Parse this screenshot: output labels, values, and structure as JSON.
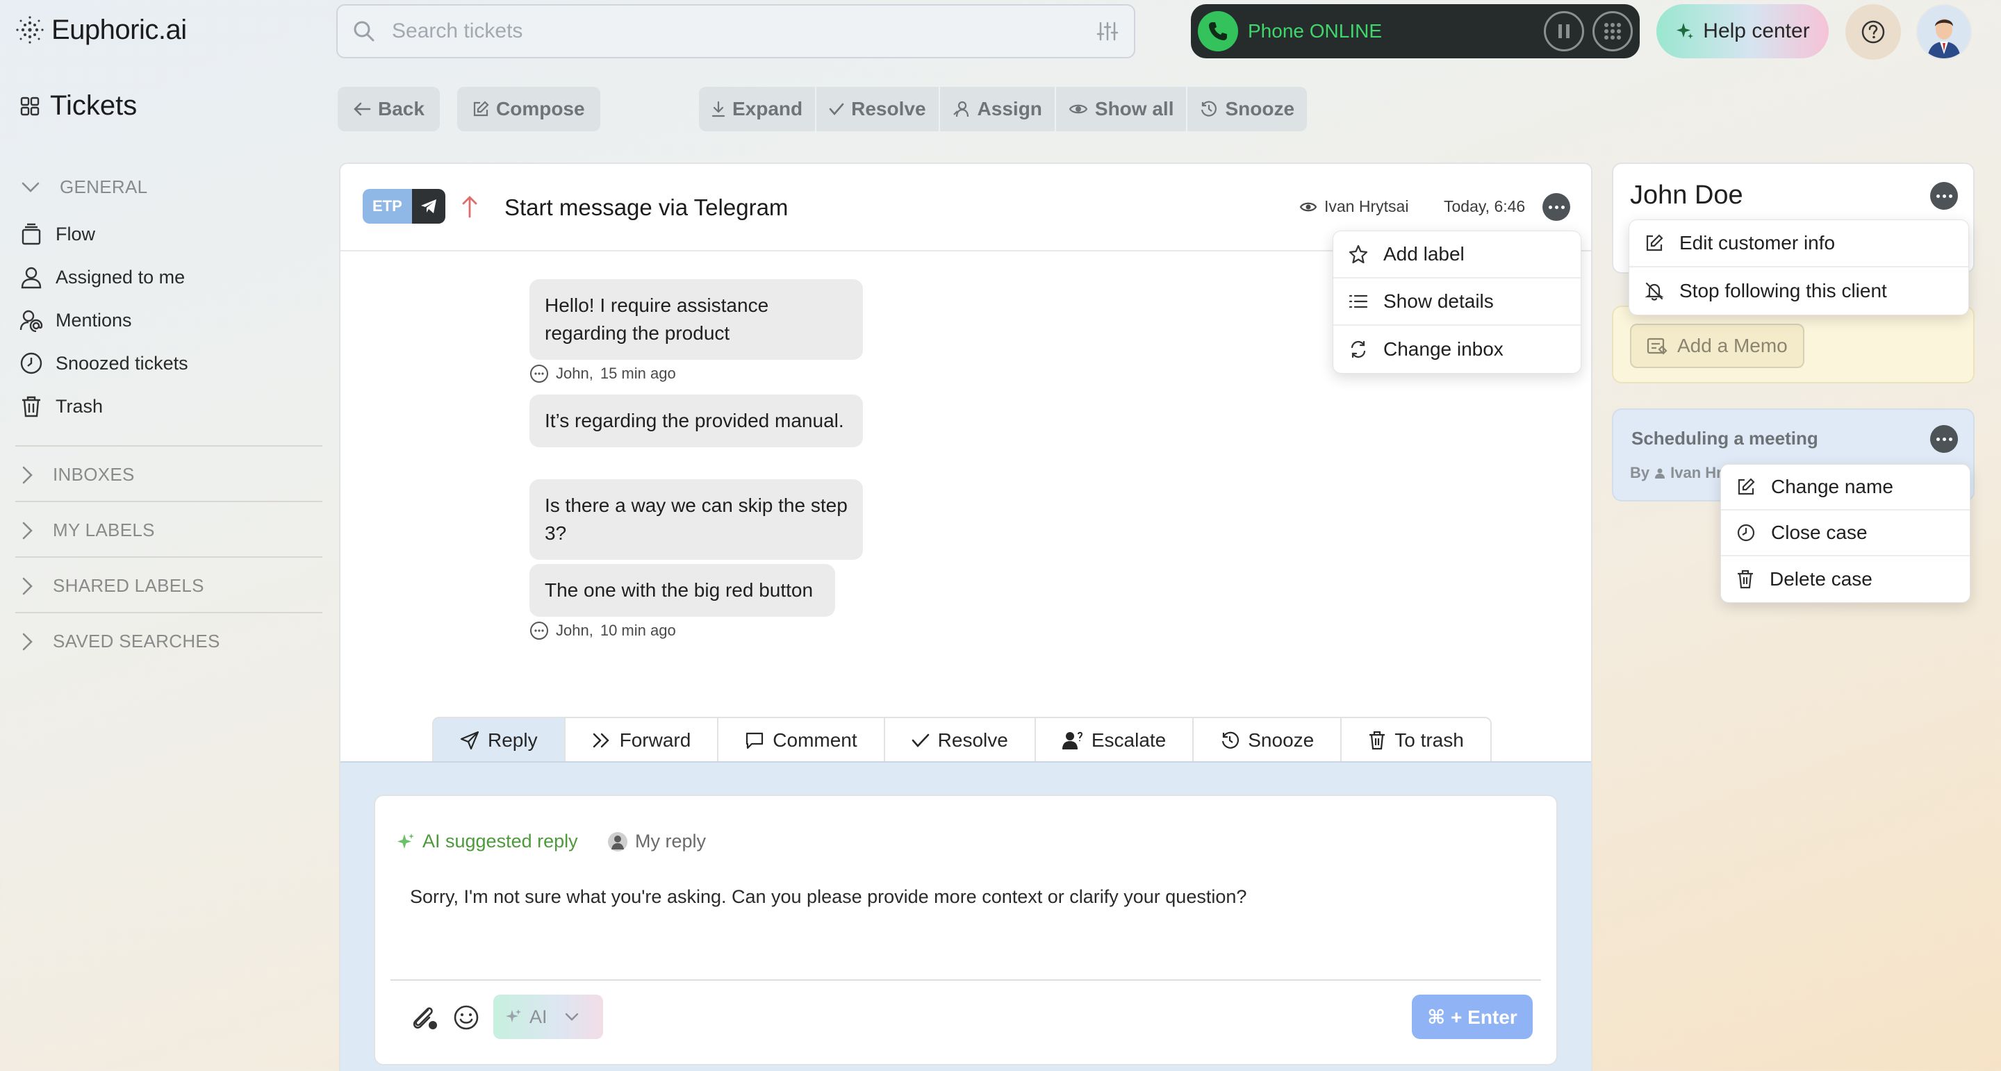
{
  "app": {
    "logo": "Euphoric.ai"
  },
  "search": {
    "placeholder": "Search tickets"
  },
  "phone": {
    "status": "Phone ONLINE"
  },
  "help": {
    "label": "Help center"
  },
  "sidebar": {
    "title": "Tickets",
    "general": {
      "label": "GENERAL",
      "items": [
        {
          "label": "Flow",
          "icon": "inbox-stack-icon"
        },
        {
          "label": "Assigned to me",
          "icon": "user-icon"
        },
        {
          "label": "Mentions",
          "icon": "at-icon"
        },
        {
          "label": "Snoozed tickets",
          "icon": "clock-icon"
        },
        {
          "label": "Trash",
          "icon": "trash-icon"
        }
      ]
    },
    "sections": [
      "INBOXES",
      "MY LABELS",
      "SHARED LABELS",
      "SAVED SEARCHES"
    ]
  },
  "toolbar": {
    "back": "Back",
    "compose": "Compose",
    "group": [
      "Expand",
      "Resolve",
      "Assign",
      "Show all",
      "Snooze"
    ]
  },
  "ticket": {
    "badge": "ETP",
    "title": "Start message via Telegram",
    "viewer": "Ivan Hrytsai",
    "time": "Today, 6:46",
    "messages": [
      {
        "text": "Hello! I require assistance regarding the product"
      },
      {
        "meta_author": "John,",
        "meta_time": "15 min ago"
      },
      {
        "text": "It’s regarding the provided manual."
      },
      {
        "text": "Is there a way we can skip the step 3?"
      },
      {
        "text": "The one with the big red button"
      },
      {
        "meta_author": "John,",
        "meta_time": "10 min ago"
      }
    ],
    "menu": [
      "Add label",
      "Show details",
      "Change inbox"
    ]
  },
  "reply_tabs": [
    "Reply",
    "Forward",
    "Comment",
    "Resolve",
    "Escalate",
    "Snooze",
    "To trash"
  ],
  "composer": {
    "ai_tab": "AI suggested reply",
    "my_tab": "My reply",
    "text": "Sorry, I'm not sure what you're asking. Can you please provide more context or clarify your question?",
    "ai_button": "AI",
    "send": "⌘ + Enter"
  },
  "customer": {
    "name": "John Doe",
    "menu": [
      "Edit customer info",
      "Stop following this client"
    ],
    "memo": "Add a Memo"
  },
  "case": {
    "title": "Scheduling a meeting",
    "by_prefix": "By",
    "by_name": "Ivan Hr",
    "menu": [
      "Change name",
      "Close case",
      "Delete case"
    ]
  },
  "colors": {
    "accent_green": "#33c25b",
    "send_blue": "#8fb3f5",
    "telegram_dark": "#2e3234",
    "priority_red": "#e06b6b"
  }
}
